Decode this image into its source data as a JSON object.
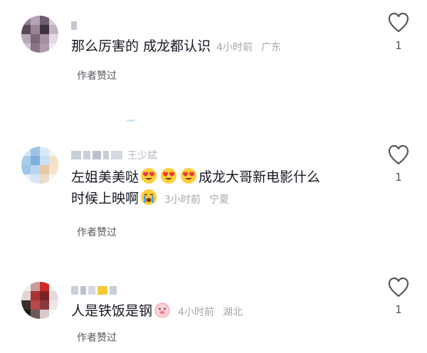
{
  "comments": [
    {
      "username": "",
      "text": "那么厉害的 成龙都认识",
      "time": "4小时前",
      "location": "广东",
      "liked_by_author": "作者赞过",
      "like_count": "1",
      "avatar_icon": "pixelated-avatar"
    },
    {
      "username": "王少斌",
      "text_line1": "左姐美美哒",
      "text_line1b": "成龙大哥新电影什么",
      "text_line2": "时候上映啊",
      "time": "3小时前",
      "location": "宁夏",
      "liked_by_author": "作者赞过",
      "like_count": "1",
      "emojis": [
        "heart-eyes-emoji",
        "heart-eyes-emoji",
        "heart-eyes-emoji",
        "crying-emoji"
      ],
      "avatar_icon": "pixelated-avatar"
    },
    {
      "username": "",
      "text": "人是铁饭是钢",
      "time": "4小时前",
      "location": "湖北",
      "liked_by_author": "作者赞过",
      "like_count": "1",
      "emojis": [
        "pig-emoji"
      ],
      "avatar_icon": "pixelated-avatar"
    }
  ],
  "icons": {
    "like": "heart-outline-icon"
  },
  "colors": {
    "meta": "#a4a7af",
    "text": "#161823",
    "secondary": "#55585f"
  }
}
